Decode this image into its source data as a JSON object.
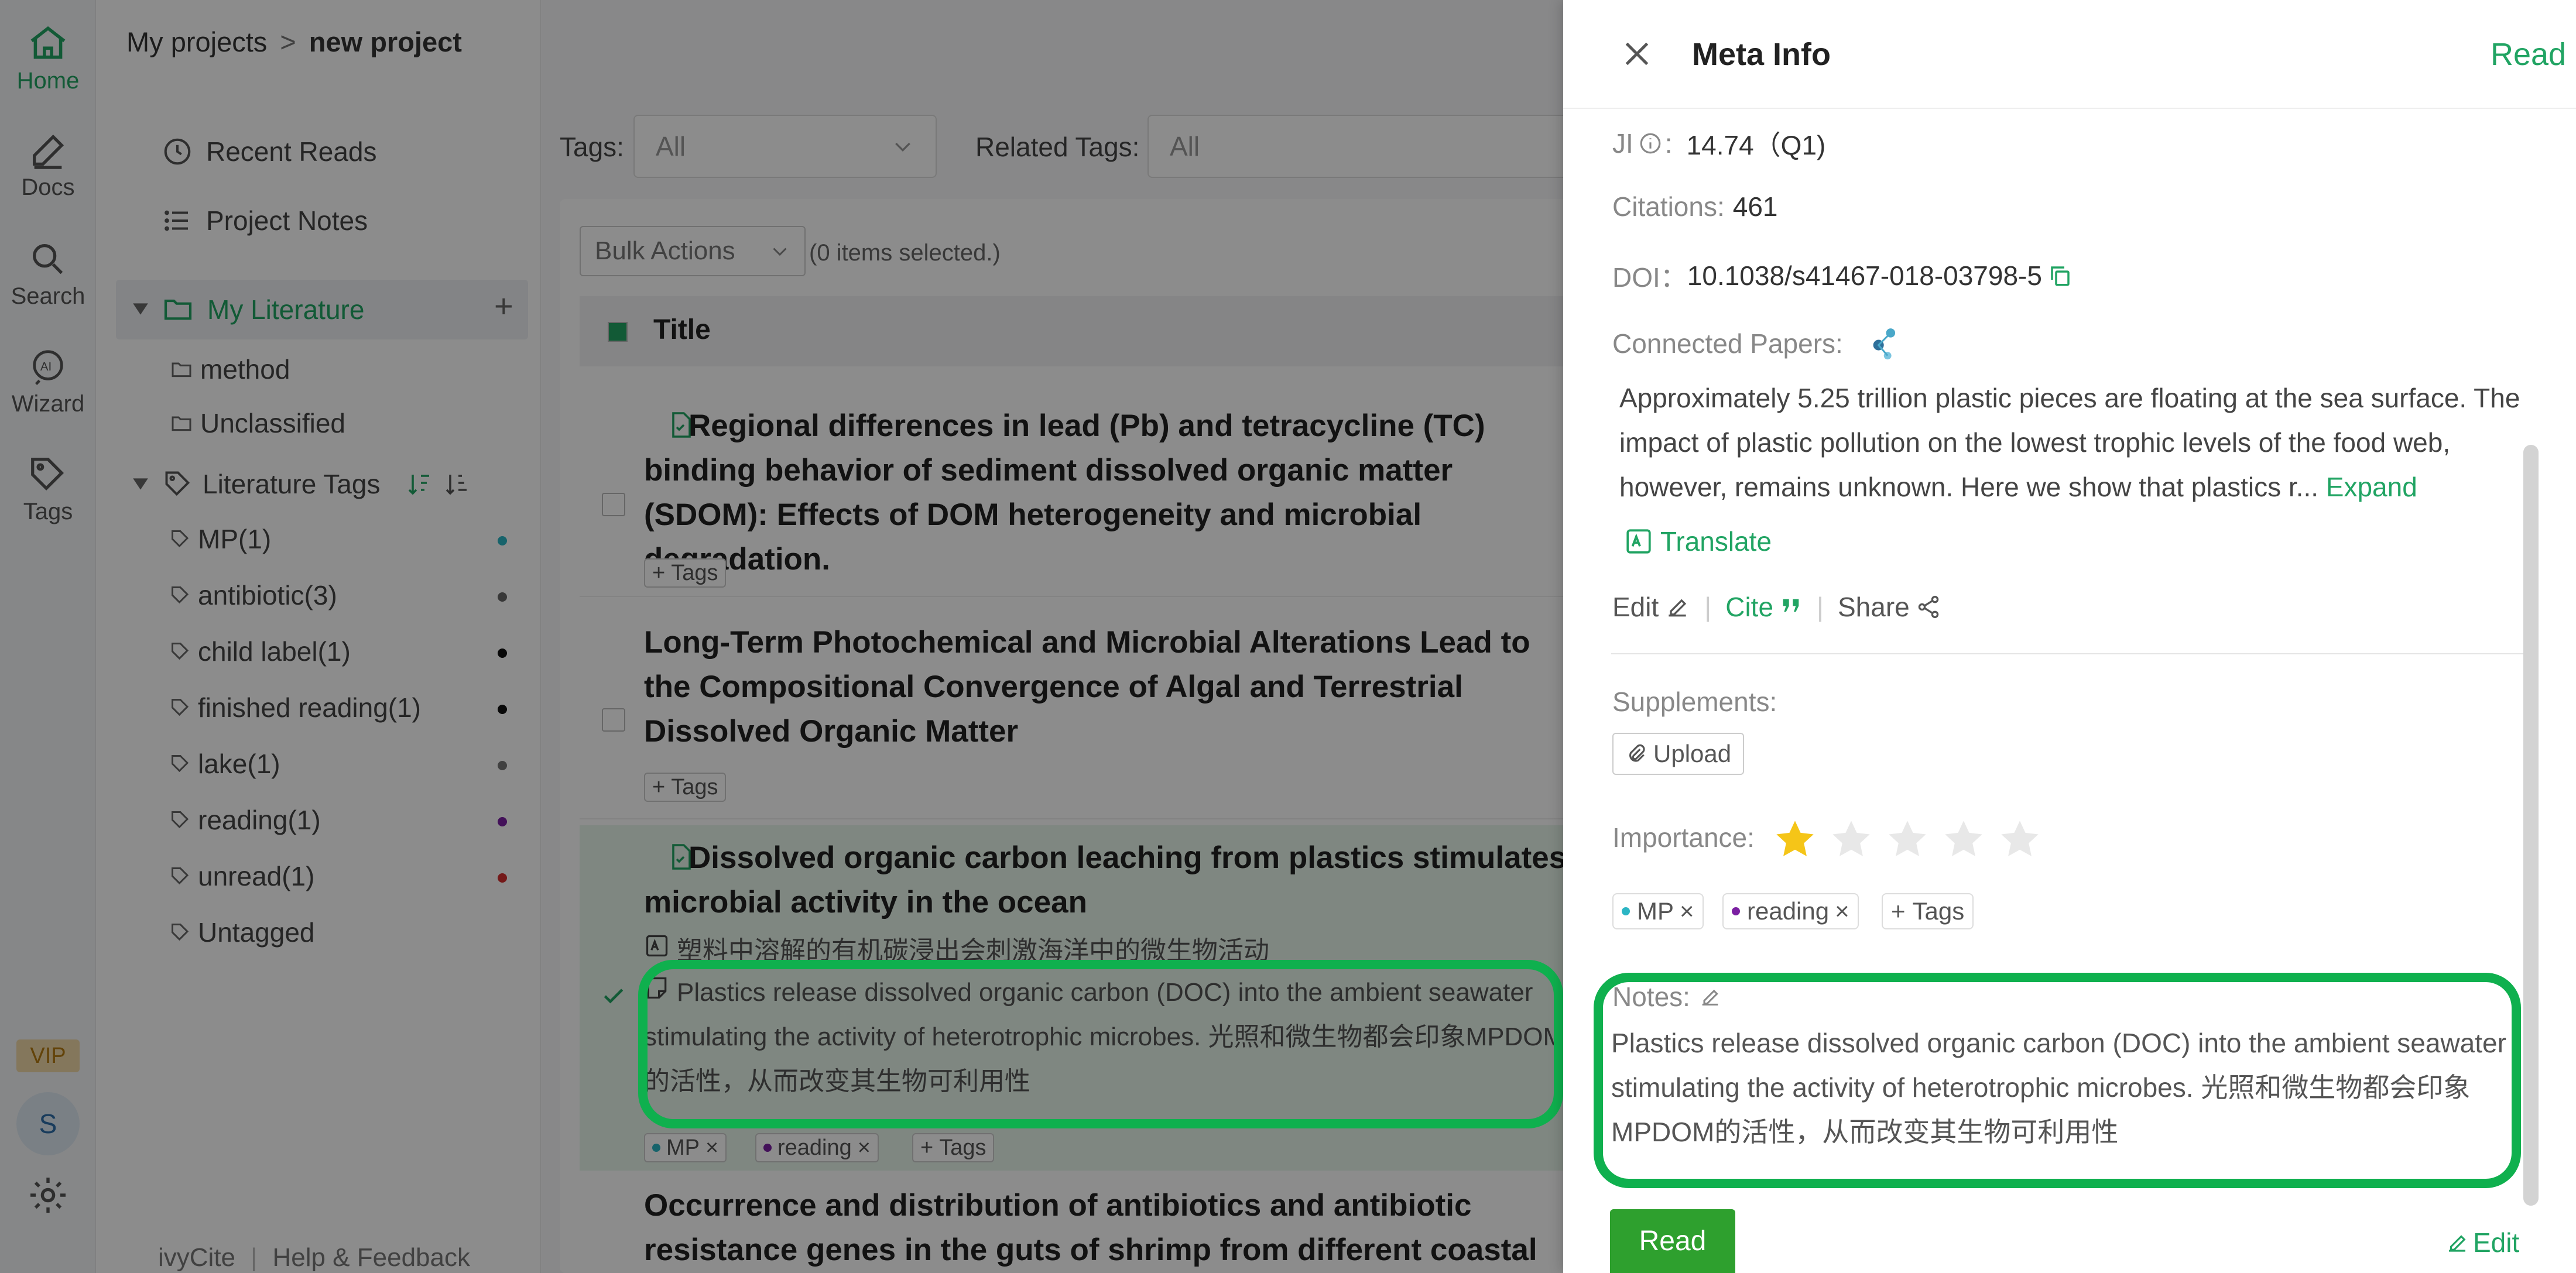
{
  "rail": {
    "items": [
      {
        "label": "Home",
        "icon": "home-icon"
      },
      {
        "label": "Docs",
        "icon": "pen-icon"
      },
      {
        "label": "Search",
        "icon": "search-icon"
      },
      {
        "label": "Wizard",
        "icon": "ai-icon"
      },
      {
        "label": "Tags",
        "icon": "tag-icon"
      }
    ],
    "vip": "VIP",
    "avatar": "S"
  },
  "breadcrumb": {
    "root": "My projects",
    "sep": ">",
    "current": "new project"
  },
  "sidebar": {
    "recent_reads": "Recent Reads",
    "project_notes": "Project Notes",
    "my_literature": "My Literature",
    "folders": [
      "method",
      "Unclassified"
    ],
    "literature_tags": "Literature Tags",
    "tags": [
      {
        "label": "MP(1)",
        "color": "#2bb5c4"
      },
      {
        "label": "antibiotic(3)",
        "color": "#666666"
      },
      {
        "label": "child label(1)",
        "color": "#111111"
      },
      {
        "label": "finished reading(1)",
        "color": "#111111"
      },
      {
        "label": "lake(1)",
        "color": "#777777"
      },
      {
        "label": "reading(1)",
        "color": "#7b1fa2"
      },
      {
        "label": "unread(1)",
        "color": "#d32f2f"
      },
      {
        "label": "Untagged",
        "color": ""
      }
    ],
    "footer": {
      "brand": "ivyCite",
      "help": "Help & Feedback"
    }
  },
  "filters": {
    "tags_label": "Tags:",
    "tags_value": "All",
    "related_label": "Related Tags:",
    "related_value": "All"
  },
  "bulk": {
    "button": "Bulk Actions",
    "selected": "(0 items selected.)"
  },
  "list": {
    "header": "Title",
    "papers": [
      {
        "title": "Regional differences in lead (Pb) and tetracycline (TC) binding behavior of sediment dissolved organic matter (SDOM): Effects of DOM heterogeneity and microbial degradation.",
        "tags_btn": "Tags"
      },
      {
        "title": "Long-Term Photochemical and Microbial Alterations Lead to the Compositional Convergence of Algal and Terrestrial Dissolved Organic Matter",
        "tags_btn": "Tags"
      },
      {
        "title": "Dissolved organic carbon leaching from plastics stimulates microbial activity in the ocean",
        "translation": "塑料中溶解的有机碳浸出会刺激海洋中的微生物活动",
        "note": "Plastics release dissolved organic carbon (DOC) into the ambient seawater stimulating the activity of heterotrophic microbes. 光照和微生物都会印象MPDOM的活性，从而改变其生物可利用性",
        "tags": [
          "MP",
          "reading"
        ],
        "tags_btn": "Tags"
      },
      {
        "title": "Occurrence and distribution of antibiotics and antibiotic resistance genes in the guts of shrimp from different coastal areas"
      }
    ]
  },
  "drawer": {
    "title": "Meta Info",
    "read_link": "Read",
    "ji_label": "JI",
    "ji_value": "14.74（Q1)",
    "citations_label": "Citations:",
    "citations_value": "461",
    "doi_label": "DOI：",
    "doi_value": "10.1038/s41467-018-03798-5",
    "connected_label": "Connected Papers:",
    "abstract": "Approximately 5.25 trillion plastic pieces are floating at the sea surface. The impact of plastic pollution on the lowest trophic levels of the food web, however, remains unknown. Here we show that plastics r...",
    "expand": "Expand",
    "translate": "Translate",
    "edit": "Edit",
    "cite": "Cite",
    "share": "Share",
    "supplements_label": "Supplements:",
    "upload": "Upload",
    "importance_label": "Importance:",
    "importance_stars": 1,
    "importance_max": 5,
    "tags": [
      {
        "label": "MP",
        "color": "#2bb5c4"
      },
      {
        "label": "reading",
        "color": "#7b1fa2"
      }
    ],
    "add_tags": "Tags",
    "notes_label": "Notes:",
    "notes": "Plastics release dissolved organic carbon (DOC) into the ambient seawater stimulating the activity of heterotrophic microbes. 光照和微生物都会印象MPDOM的活性，从而改变其生物可利用性",
    "read_button": "Read",
    "edit_bottom": "Edit"
  },
  "colors": {
    "accent": "#21a463",
    "highlight_ring": "#0fb04e",
    "star": "#f5c518"
  }
}
